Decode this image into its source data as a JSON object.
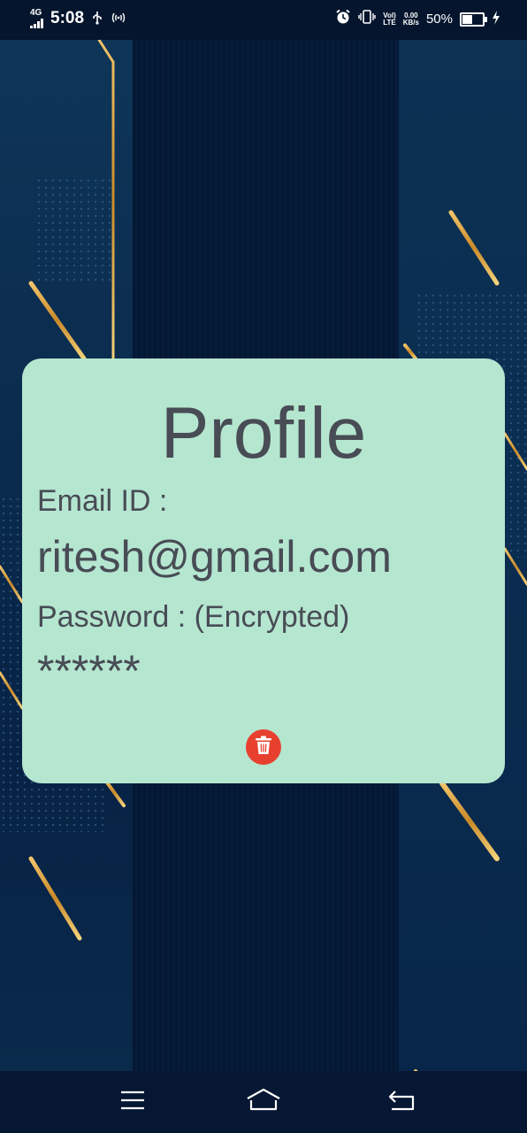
{
  "status_bar": {
    "network_type": "4G",
    "time": "5:08",
    "volte_top": "Vol)",
    "volte_bottom": "LTE",
    "speed_value": "0.00",
    "speed_unit": "KB/s",
    "battery_percent": "50%"
  },
  "profile": {
    "title": "Profile",
    "email_label": "Email ID :",
    "email_value": "ritesh@gmail.com",
    "password_label": "Password : (Encrypted)",
    "password_value": "******"
  },
  "colors": {
    "card_background": "#b5e6d0",
    "card_text": "#484c55",
    "delete_button": "#e8402f",
    "background": "#061a38",
    "accent_gold": "#d9a23c"
  },
  "icons": {
    "delete": "trash-icon",
    "nav_menu": "menu-icon",
    "nav_home": "home-icon",
    "nav_back": "back-icon"
  }
}
